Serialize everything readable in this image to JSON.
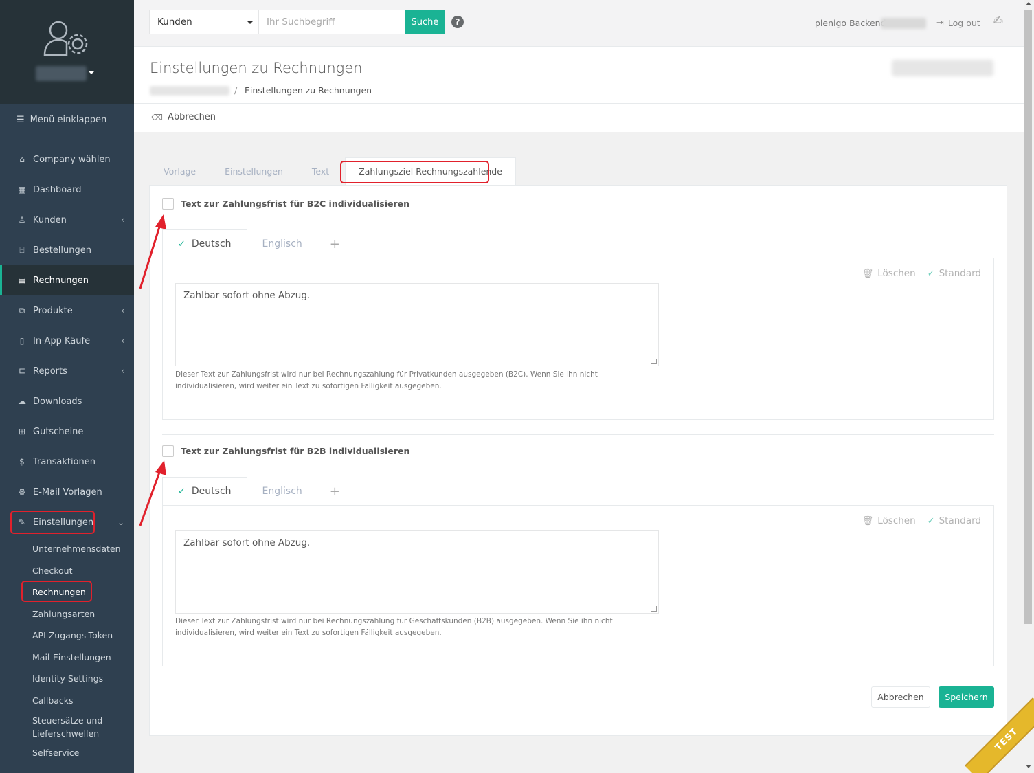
{
  "sidebar": {
    "collapse_label": "Menü einklappen",
    "items": [
      {
        "label": "Company wählen",
        "icon": "home-icon",
        "has_arrow": false
      },
      {
        "label": "Dashboard",
        "icon": "dashboard-icon",
        "has_arrow": false
      },
      {
        "label": "Kunden",
        "icon": "user-icon",
        "has_arrow": true
      },
      {
        "label": "Bestellungen",
        "icon": "basket-icon",
        "has_arrow": false
      },
      {
        "label": "Rechnungen",
        "icon": "invoice-icon",
        "has_arrow": false
      },
      {
        "label": "Produkte",
        "icon": "products-icon",
        "has_arrow": true
      },
      {
        "label": "In-App Käufe",
        "icon": "mobile-icon",
        "has_arrow": true
      },
      {
        "label": "Reports",
        "icon": "reports-icon",
        "has_arrow": true
      },
      {
        "label": "Downloads",
        "icon": "download-icon",
        "has_arrow": false
      },
      {
        "label": "Gutscheine",
        "icon": "gift-icon",
        "has_arrow": false
      },
      {
        "label": "Transaktionen",
        "icon": "transactions-icon",
        "has_arrow": false
      },
      {
        "label": "E-Mail Vorlagen",
        "icon": "mail-templates-icon",
        "has_arrow": false
      },
      {
        "label": "Einstellungen",
        "icon": "wrench-icon",
        "has_arrow": true
      }
    ],
    "subitems": [
      "Unternehmensdaten",
      "Checkout",
      "Rechnungen",
      "Zahlungsarten",
      "API Zugangs-Token",
      "Mail-Einstellungen",
      "Identity Settings",
      "Callbacks",
      "Steuersätze und Lieferschwellen",
      "Selfservice"
    ]
  },
  "topbar": {
    "search_select": "Kunden",
    "search_placeholder": "Ihr Suchbegriff",
    "search_button": "Suche",
    "help": "?",
    "backend_label": "plenigo Backend",
    "logout_label": "Log out"
  },
  "heading": {
    "title": "Einstellungen zu Rechnungen",
    "breadcrumb_sep": "/",
    "breadcrumb_current": "Einstellungen zu Rechnungen"
  },
  "actionbar": {
    "cancel_label": "Abbrechen"
  },
  "main_tabs": [
    "Vorlage",
    "Einstellungen",
    "Text",
    "Zahlungsziel Rechnungszahlende"
  ],
  "sections": [
    {
      "checkbox_label": "Text zur Zahlungsfrist für B2C individualisieren",
      "lang_tabs": [
        "Deutsch",
        "Englisch"
      ],
      "delete_label": "Löschen",
      "standard_label": "Standard",
      "text": "Zahlbar sofort ohne Abzug.",
      "help": "Dieser Text zur Zahlungsfrist wird nur bei Rechnungszahlung für Privatkunden ausgegeben (B2C). Wenn Sie ihn nicht individualisieren, wird weiter ein Text zu sofortigen Fälligkeit ausgegeben."
    },
    {
      "checkbox_label": "Text zur Zahlungsfrist für B2B individualisieren",
      "lang_tabs": [
        "Deutsch",
        "Englisch"
      ],
      "delete_label": "Löschen",
      "standard_label": "Standard",
      "text": "Zahlbar sofort ohne Abzug.",
      "help": "Dieser Text zur Zahlungsfrist wird nur bei Rechnungszahlung für Geschäftskunden (B2B) ausgegeben. Wenn Sie ihn nicht individualisieren, wird weiter ein Text zu sofortigen Fälligkeit ausgegeben."
    }
  ],
  "footer_buttons": {
    "cancel": "Abbrechen",
    "save": "Speichern"
  },
  "ribbon": "TEST",
  "colors": {
    "sidebar": "#2f4050",
    "accent": "#1ab394",
    "highlight": "#e1212c",
    "ribbon": "#e5b82b"
  }
}
